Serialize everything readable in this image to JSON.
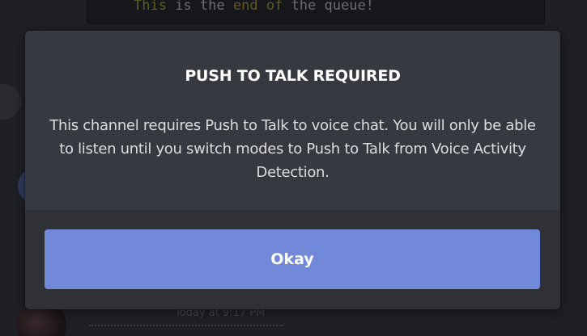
{
  "background": {
    "code_line_parts": [
      "This",
      " is ",
      "the",
      " ",
      "end",
      " ",
      "of",
      " the queue!"
    ],
    "timestamp": "Today at 9:17 PM"
  },
  "modal": {
    "title": "PUSH TO TALK REQUIRED",
    "message": "This channel requires Push to Talk to voice chat. You will only be able to listen until you switch modes to Push to Talk from Voice Activity Detection.",
    "okay_label": "Okay"
  },
  "colors": {
    "modal_bg": "#36393f",
    "footer_bg": "#2f3136",
    "button_bg": "#7289da",
    "title_text": "#ffffff",
    "body_text": "#dcddde"
  }
}
